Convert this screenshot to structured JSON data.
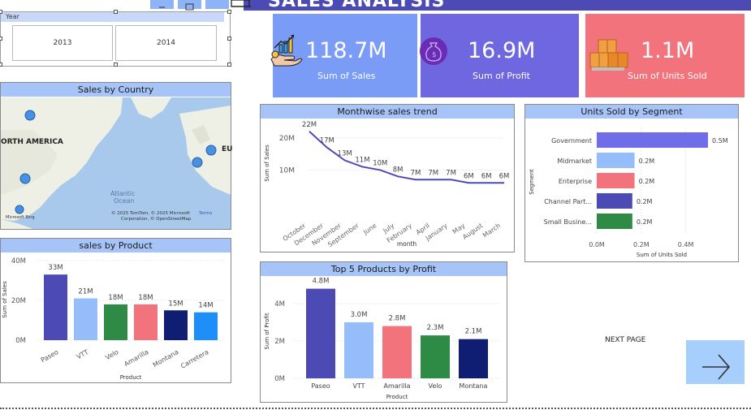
{
  "header": {
    "title": "SALES ANALYSIS"
  },
  "slicer": {
    "header": "Year",
    "options": [
      "2013",
      "2014"
    ]
  },
  "kpis": [
    {
      "value": "118.7M",
      "label": "Sum of  Sales",
      "color": "#7a9cf7",
      "icon": "hand-growth-chart-icon"
    },
    {
      "value": "16.9M",
      "label": "Sum of Profit",
      "color": "#6f67e0",
      "icon": "money-bag-icon"
    },
    {
      "value": "1.1M",
      "label": "Sum of Units Sold",
      "color": "#f2737b",
      "icon": "stacked-boxes-icon"
    }
  ],
  "map": {
    "title": "Sales by Country",
    "region_label": "ORTH AMERICA",
    "region_label_2": "EU",
    "ocean_label_1": "Atlantic",
    "ocean_label_2": "Ocean",
    "attribution_1": "© 2025 TomTom, © 2025 Microsoft",
    "attribution_link": "Terms",
    "attribution_2": "Corporation, © OpenStreetMap",
    "logo": "Microsoft Bing"
  },
  "nav": {
    "next_label": "NEXT PAGE",
    "arrow_icon": "arrow-right-icon"
  },
  "chart_data": [
    {
      "id": "monthwise",
      "type": "line",
      "title": "Monthwise sales trend",
      "xlabel": "month",
      "ylabel": "Sum of Sales",
      "categories": [
        "October",
        "December",
        "November",
        "September",
        "June",
        "July",
        "February",
        "April",
        "January",
        "May",
        "August",
        "March"
      ],
      "values": [
        22,
        17,
        13,
        11,
        10,
        8,
        7,
        7,
        7,
        6,
        6,
        6
      ],
      "data_labels": [
        "22M",
        "17M",
        "13M",
        "11M",
        "10M",
        "8M",
        "7M",
        "7M",
        "7M",
        "6M",
        "6M",
        "6M"
      ],
      "yticks": [
        "10M",
        "20M"
      ],
      "ytick_values": [
        10,
        20
      ],
      "ylim": [
        0,
        24
      ],
      "color": "#4c4bb5"
    },
    {
      "id": "segment",
      "type": "bar",
      "orientation": "horizontal",
      "title": "Units Sold by Segment",
      "xlabel": "Sum of Units Sold",
      "ylabel": "Segment",
      "categories": [
        "Government",
        "Midmarket",
        "Enterprise",
        "Channel Part...",
        "Small Busine..."
      ],
      "values": [
        0.5,
        0.17,
        0.17,
        0.16,
        0.16
      ],
      "data_labels": [
        "0.5M",
        "0.2M",
        "0.2M",
        "0.2M",
        "0.2M"
      ],
      "colors": [
        "#6f6ee8",
        "#94bdf9",
        "#f2737b",
        "#4c4bb5",
        "#2e8b46"
      ],
      "xticks": [
        "0.0M",
        "0.2M",
        "0.4M"
      ],
      "xtick_values": [
        0,
        0.2,
        0.4
      ],
      "xlim": [
        0,
        0.5
      ]
    },
    {
      "id": "product",
      "type": "bar",
      "title": "sales by Product",
      "xlabel": "Product",
      "ylabel": "Sum of Sales",
      "categories": [
        "Paseo",
        "VTT",
        "Velo",
        "Amarilla",
        "Montana",
        "Carretera"
      ],
      "values": [
        33,
        21,
        18,
        18,
        15,
        14
      ],
      "data_labels": [
        "33M",
        "21M",
        "18M",
        "18M",
        "15M",
        "14M"
      ],
      "colors": [
        "#4c4bb5",
        "#94bdf9",
        "#2e8b46",
        "#f2737b",
        "#0f1d72",
        "#1e8ff8"
      ],
      "yticks": [
        "0M",
        "20M",
        "40M"
      ],
      "ytick_values": [
        0,
        20,
        40
      ],
      "ylim": [
        0,
        40
      ]
    },
    {
      "id": "top5",
      "type": "bar",
      "title": "Top 5 Products by Profit",
      "xlabel": "Product",
      "ylabel": "Sum of Profit",
      "categories": [
        "Paseo",
        "VTT",
        "Amarilla",
        "Velo",
        "Montana"
      ],
      "values": [
        4.8,
        3.0,
        2.8,
        2.3,
        2.1
      ],
      "data_labels": [
        "4.8M",
        "3.0M",
        "2.8M",
        "2.3M",
        "2.1M"
      ],
      "colors": [
        "#4c4bb5",
        "#94bdf9",
        "#f2737b",
        "#2e8b46",
        "#0f1d72"
      ],
      "yticks": [
        "0M",
        "2M",
        "4M"
      ],
      "ytick_values": [
        0,
        2,
        4
      ],
      "ylim": [
        0,
        5
      ]
    }
  ]
}
